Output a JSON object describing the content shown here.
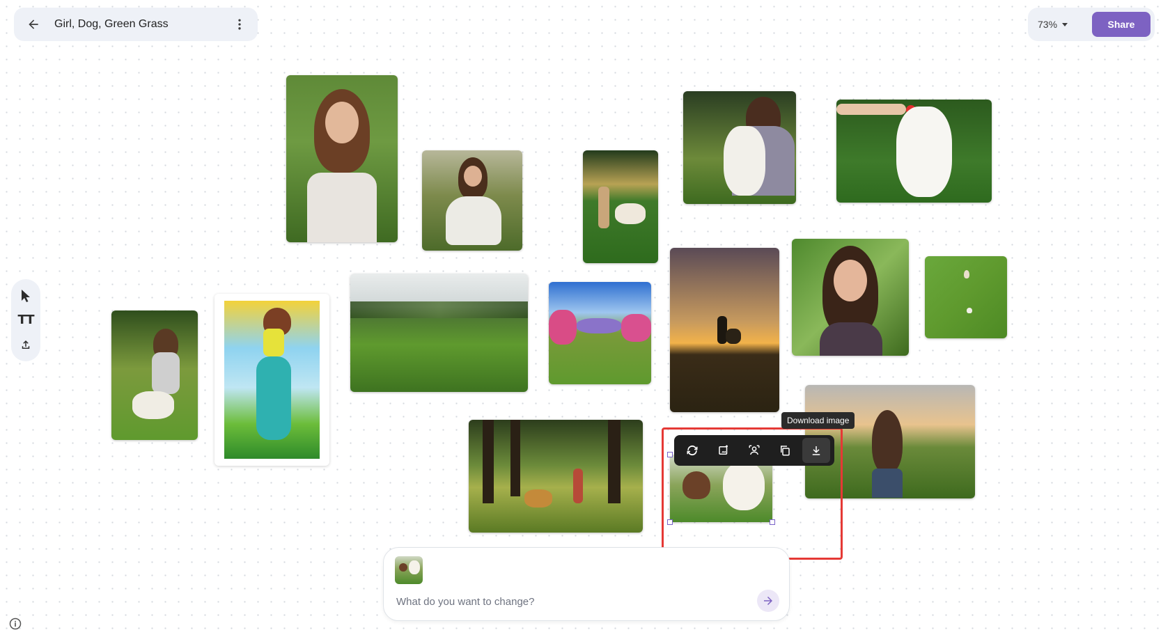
{
  "header": {
    "title": "Girl, Dog, Green Grass",
    "back_icon": "arrow-left-icon",
    "more_icon": "more-vert-icon"
  },
  "zoom": {
    "level": "73%"
  },
  "share": {
    "label": "Share"
  },
  "tools": {
    "items": [
      "select-tool",
      "text-tool",
      "upload-tool"
    ],
    "text_glyph": "TT"
  },
  "image_toolbar": {
    "tooltip": "Download image",
    "buttons": [
      "regenerate-icon",
      "expand-image-icon",
      "edit-subject-icon",
      "duplicate-icon",
      "download-icon"
    ]
  },
  "prompt": {
    "placeholder": "What do you want to change?"
  },
  "colors": {
    "accent": "#7d62c2",
    "selection_frame": "#e53935",
    "grass": "#4f8a2e"
  }
}
